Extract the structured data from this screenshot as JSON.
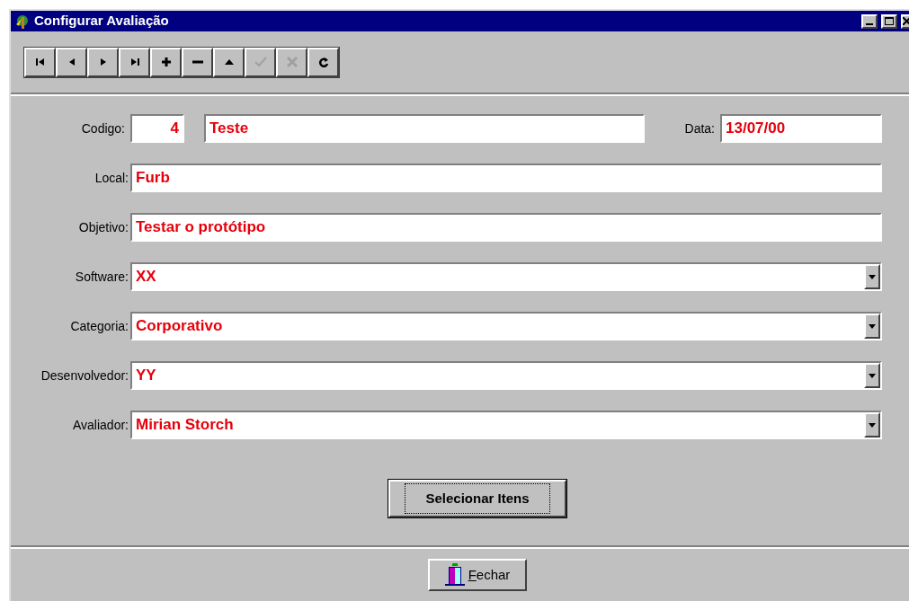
{
  "window": {
    "title": "Configurar Avaliação"
  },
  "toolbar": [
    {
      "kind": "first",
      "disabled": false
    },
    {
      "kind": "prior",
      "disabled": false
    },
    {
      "kind": "next",
      "disabled": false
    },
    {
      "kind": "last",
      "disabled": false
    },
    {
      "kind": "insert",
      "disabled": false
    },
    {
      "kind": "delete",
      "disabled": false
    },
    {
      "kind": "edit",
      "disabled": false
    },
    {
      "kind": "post",
      "disabled": true
    },
    {
      "kind": "cancel",
      "disabled": true
    },
    {
      "kind": "refresh",
      "disabled": false
    }
  ],
  "header_row": {
    "code_label": "Codigo:",
    "code": "4",
    "name": "Teste",
    "date_label": "Data:",
    "date": "13/07/00"
  },
  "fields": [
    {
      "label": "Local:",
      "value": "Furb",
      "kind": "text"
    },
    {
      "label": "Objetivo:",
      "value": "Testar o protótipo",
      "kind": "text"
    },
    {
      "label": "Software:",
      "value": "XX",
      "kind": "combo"
    },
    {
      "label": "Categoria:",
      "value": "Corporativo",
      "kind": "combo"
    },
    {
      "label": "Desenvolvedor:",
      "value": "YY",
      "kind": "combo"
    },
    {
      "label": "Avaliador:",
      "value": "Mirian Storch",
      "kind": "combo"
    }
  ],
  "select_button": "Selecionar Itens",
  "close_button": "Fechar"
}
